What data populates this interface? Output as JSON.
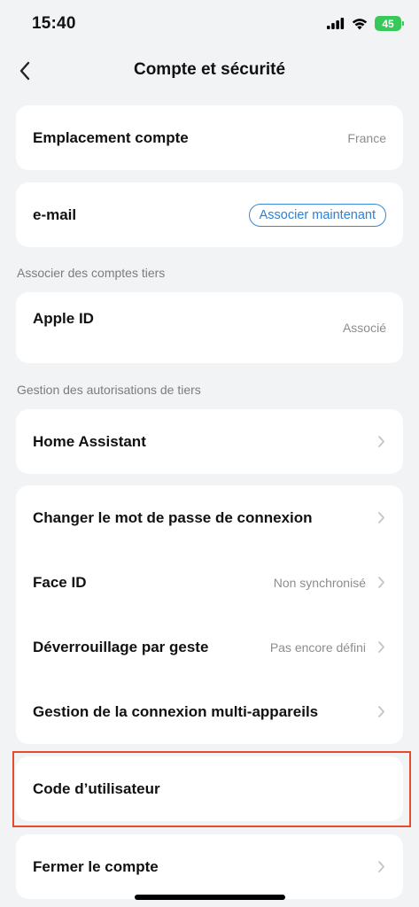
{
  "status_bar": {
    "time": "15:40",
    "battery": "45"
  },
  "nav": {
    "title": "Compte et sécurité"
  },
  "account_location": {
    "label": "Emplacement compte",
    "value": "France"
  },
  "email": {
    "label": "e-mail",
    "action": "Associer maintenant"
  },
  "third_party_accounts": {
    "section_label": "Associer des comptes tiers",
    "apple_id": {
      "label": "Apple ID",
      "value": "Associé"
    }
  },
  "third_party_permissions": {
    "section_label": "Gestion des autorisations de tiers",
    "home_assistant": {
      "label": "Home Assistant"
    }
  },
  "security": {
    "items": [
      {
        "label": "Changer le mot de passe de connexion",
        "value": ""
      },
      {
        "label": "Face ID",
        "value": "Non synchronisé"
      },
      {
        "label": "Déverrouillage par geste",
        "value": "Pas encore défini"
      },
      {
        "label": "Gestion de la connexion multi-appareils",
        "value": ""
      }
    ]
  },
  "user_code": {
    "label": "Code d’utilisateur"
  },
  "close_account": {
    "label": "Fermer le compte"
  },
  "colors": {
    "accent": "#2f7fd3",
    "highlight": "#e64b2e",
    "battery": "#38c759",
    "background": "#f2f3f5"
  }
}
